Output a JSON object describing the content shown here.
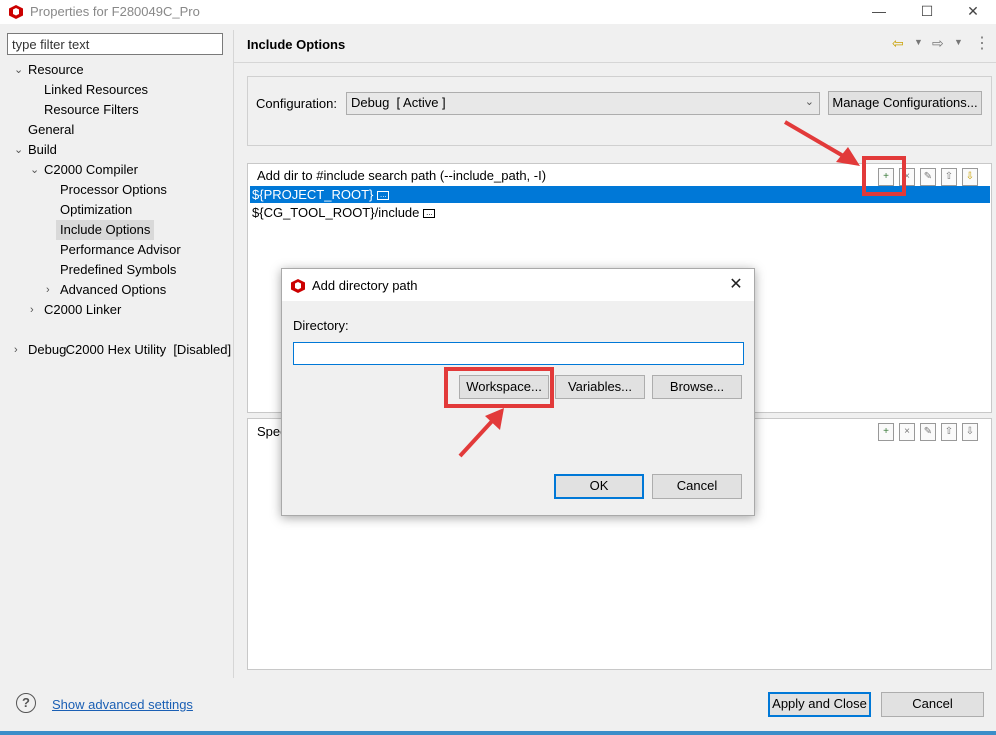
{
  "window": {
    "title": "Properties for F280049C_Pro",
    "minimize_glyph": "—",
    "maximize_glyph": "☐",
    "close_glyph": "✕"
  },
  "filter": {
    "placeholder": "type filter text",
    "value": "type filter text"
  },
  "tree": {
    "resource": "Resource",
    "linked_resources": "Linked Resources",
    "resource_filters": "Resource Filters",
    "general": "General",
    "build": "Build",
    "c2000_compiler": "C2000 Compiler",
    "processor_options": "Processor Options",
    "optimization": "Optimization",
    "include_options": "Include Options",
    "performance_advisor": "Performance Advisor",
    "predefined_symbols": "Predefined Symbols",
    "advanced_options": "Advanced Options",
    "c2000_linker": "C2000 Linker",
    "c2000_hex_utility": "C2000 Hex Utility  [Disabled]",
    "debug": "Debug"
  },
  "page": {
    "title": "Include Options"
  },
  "configuration": {
    "label": "Configuration:",
    "selected": "Debug  [ Active ]",
    "manage_button": "Manage Configurations..."
  },
  "include_paths": {
    "header": "Add dir to #include search path (--include_path, -I)",
    "items": [
      "${PROJECT_ROOT}",
      "${CG_TOOL_ROOT}/include"
    ]
  },
  "second_list": {
    "header_partial": "Spec"
  },
  "dialog": {
    "title": "Add directory path",
    "directory_label": "Directory:",
    "directory_value": "",
    "workspace_button": "Workspace...",
    "variables_button": "Variables...",
    "browse_button": "Browse...",
    "ok_button": "OK",
    "cancel_button": "Cancel"
  },
  "bottom": {
    "advanced_link": "Show advanced settings",
    "apply_close_button": "Apply and Close",
    "cancel_button": "Cancel"
  },
  "colors": {
    "accent": "#0078d7",
    "annotation_red": "#e23a3a",
    "brand_red": "#cc0000"
  }
}
